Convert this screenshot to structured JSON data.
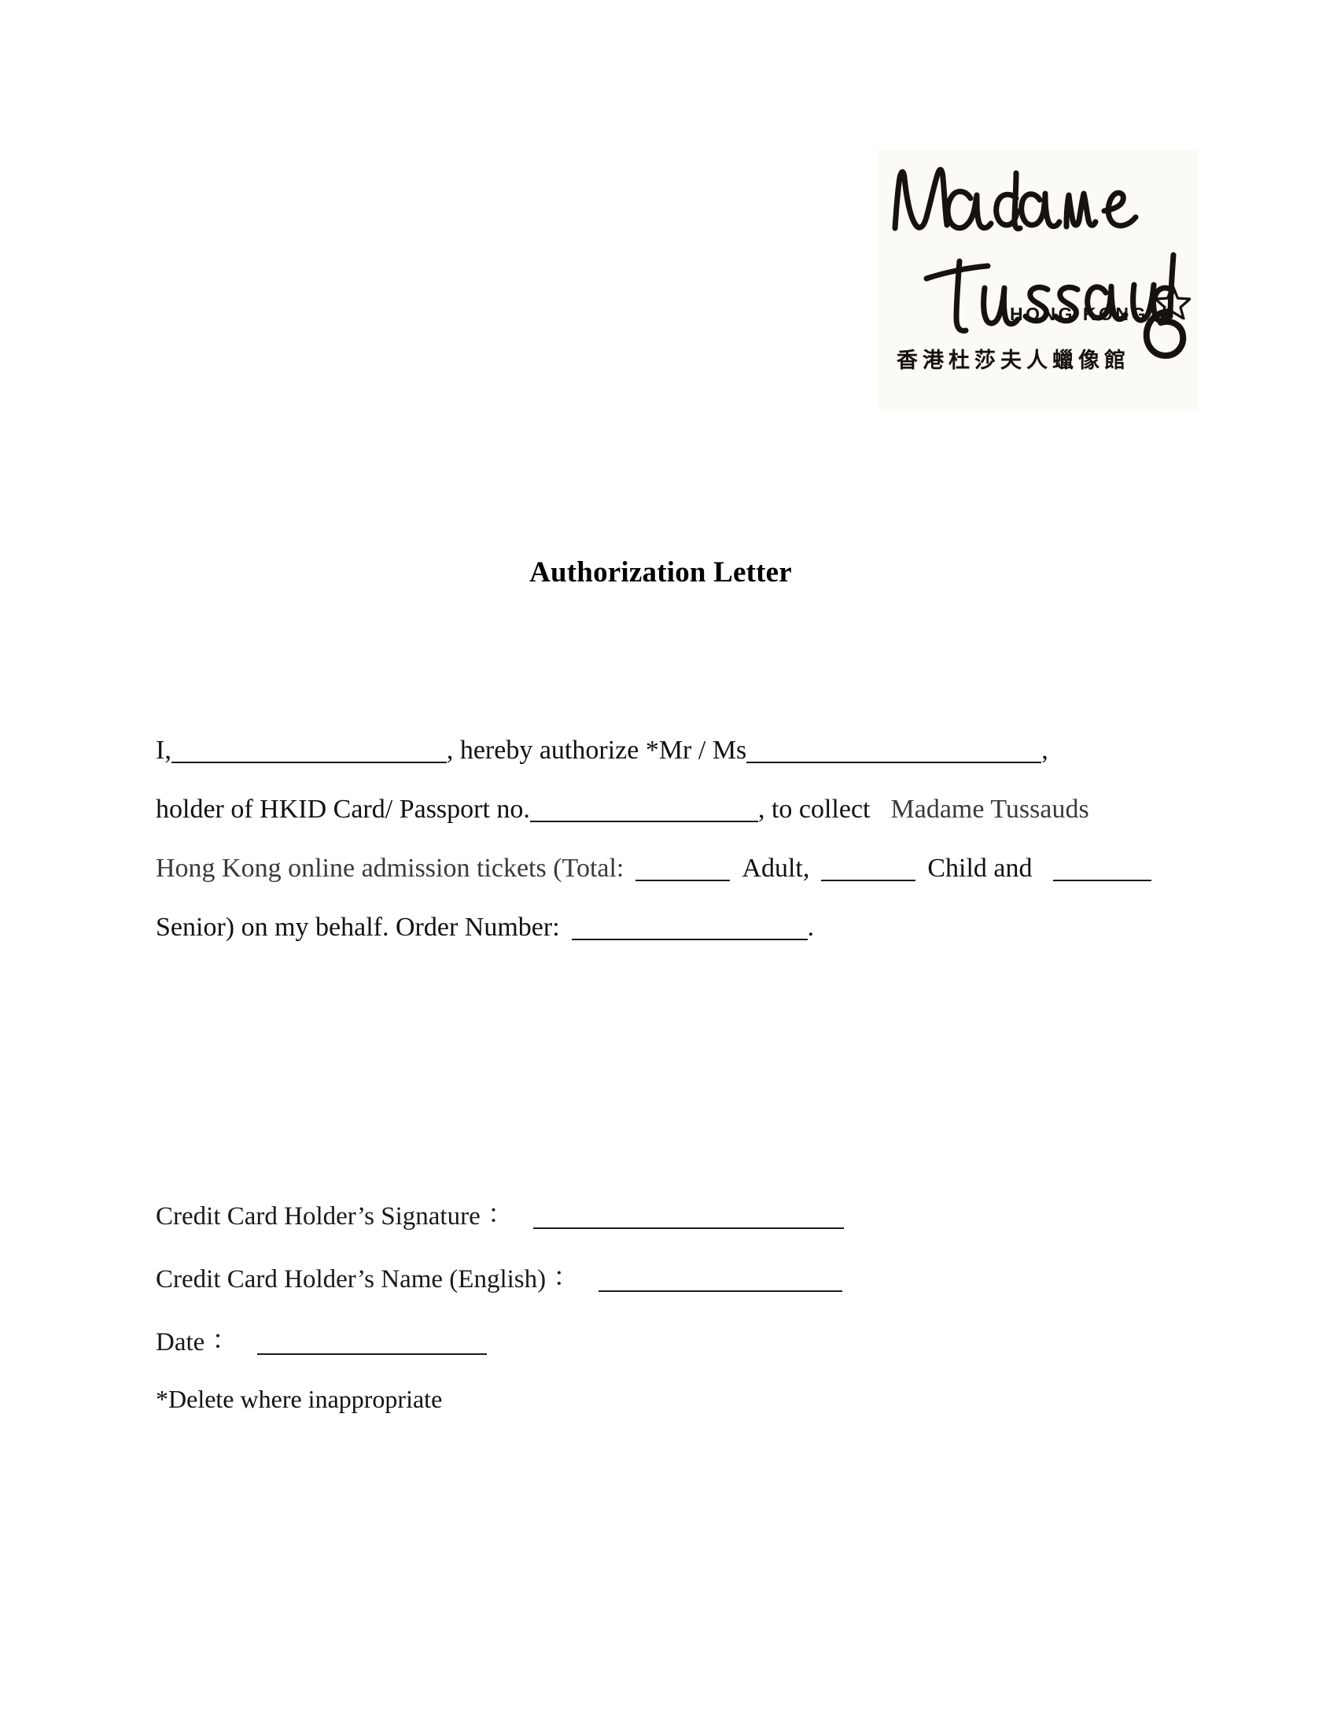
{
  "document": {
    "title": "Authorization Letter",
    "page_background": "#ffffff",
    "text_color": "#111111",
    "muted_text_color": "#3a3a3a"
  },
  "logo": {
    "name": "madame-tussauds-hong-kong-logo",
    "wordmark_line1": "Madame",
    "wordmark_line2": "Tussauds",
    "location": "HONG KONG",
    "chinese_name": "香港杜莎夫人蠟像館",
    "background_color": "#fbfaf5",
    "ink_color": "#15120f",
    "star_glyph": "star-icon"
  },
  "body": {
    "line1": {
      "a": "I,",
      "b": ", hereby authorize *Mr / Ms",
      "c": ","
    },
    "line2": {
      "a": "holder of  HKID  Card/  Passport  no.",
      "b": ",  to  collect",
      "c": "Madame  Tussauds"
    },
    "line3": {
      "a": "Hong  Kong  online  admission  tickets  (Total:",
      "b": "Adult,",
      "c": "Child  and"
    },
    "line4": {
      "a": "Senior)  on my behalf. Order Number:",
      "b": "."
    }
  },
  "signature": {
    "signature_label": "Credit Card Holder’s Signature",
    "name_label": "Credit Card Holder’s Name (English)",
    "date_label": "Date",
    "colon": "："
  },
  "footnote": {
    "text": "*Delete where inappropriate"
  }
}
